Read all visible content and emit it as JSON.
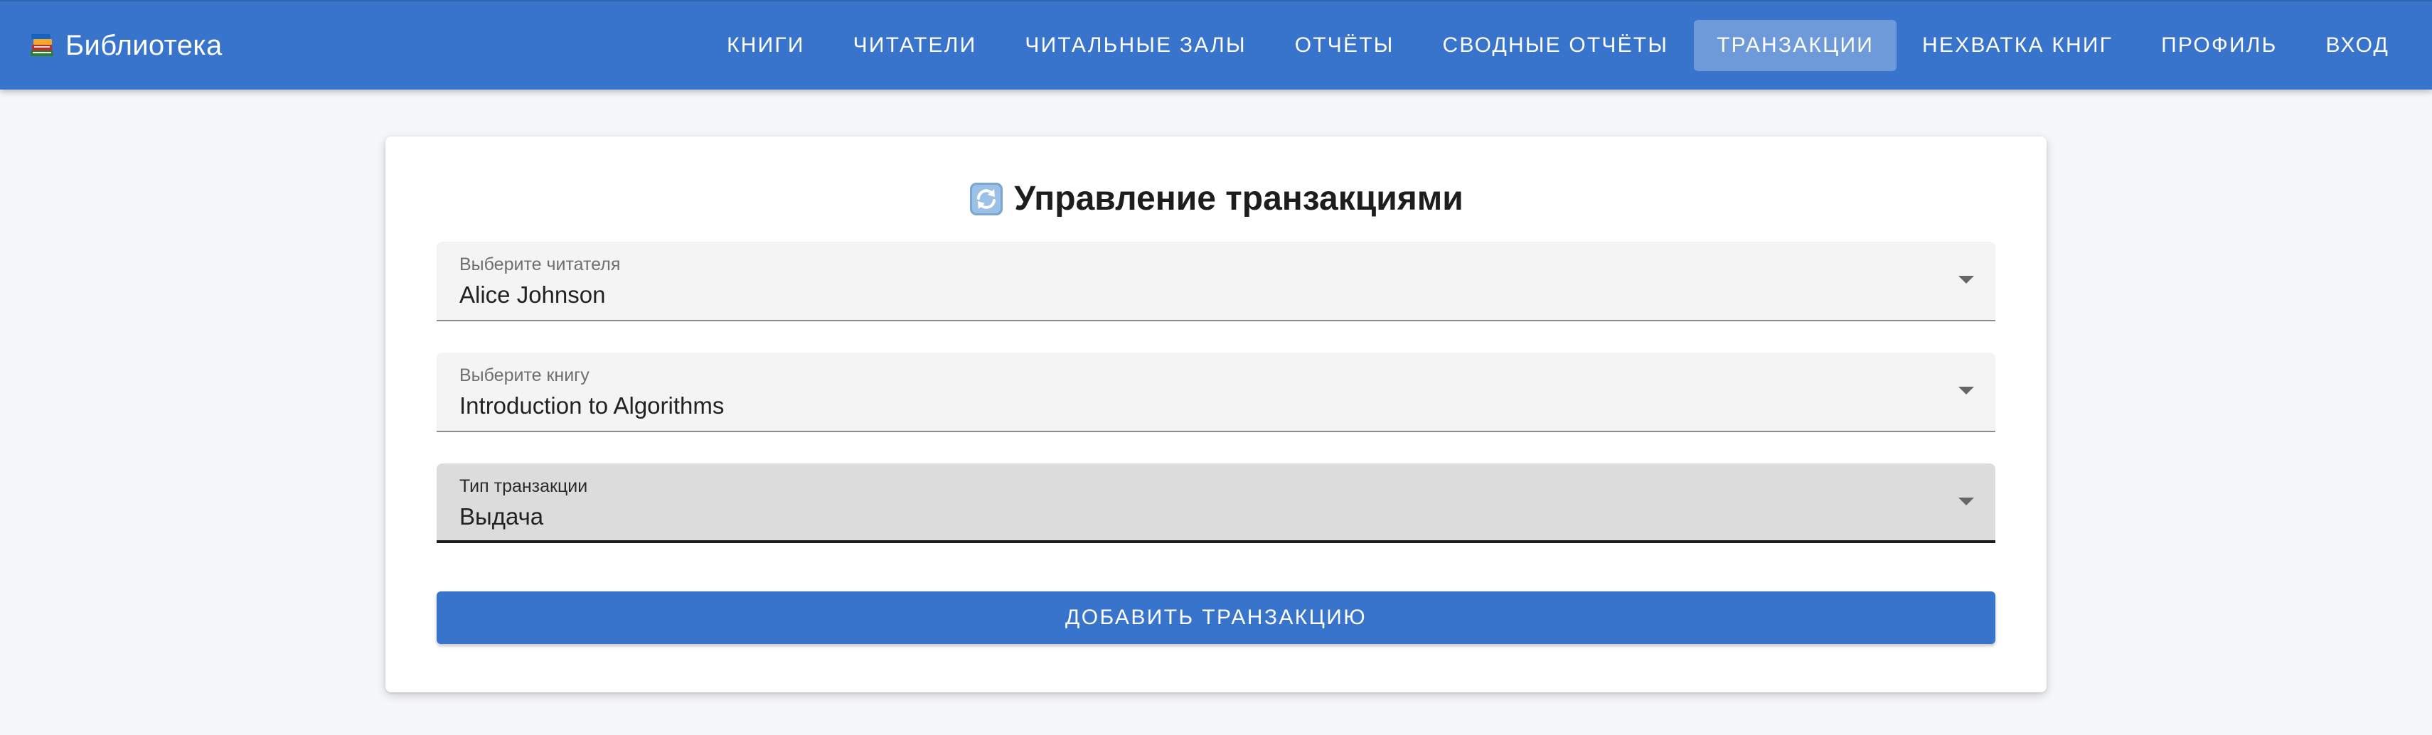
{
  "app": {
    "title": "Библиотека",
    "brand_icon": "books-icon"
  },
  "nav": {
    "items": [
      {
        "label": "Книги",
        "active": false
      },
      {
        "label": "Читатели",
        "active": false
      },
      {
        "label": "Читальные залы",
        "active": false
      },
      {
        "label": "Отчёты",
        "active": false
      },
      {
        "label": "Сводные отчёты",
        "active": false
      },
      {
        "label": "Транзакции",
        "active": true
      },
      {
        "label": "Нехватка книг",
        "active": false
      },
      {
        "label": "Профиль",
        "active": false
      },
      {
        "label": "Вход",
        "active": false
      }
    ]
  },
  "page": {
    "title": "Управление транзакциями",
    "title_icon": "refresh-icon"
  },
  "form": {
    "reader": {
      "label": "Выберите читателя",
      "value": "Alice Johnson"
    },
    "book": {
      "label": "Выберите книгу",
      "value": "Introduction to Algorithms"
    },
    "type": {
      "label": "Тип транзакции",
      "value": "Выдача"
    },
    "submit_label": "Добавить транзакцию"
  },
  "colors": {
    "primary": "#3874cb",
    "background": "#f6f7f9",
    "field_bg": "#f4f4f4",
    "field_focused_bg": "#dcdcdc"
  }
}
